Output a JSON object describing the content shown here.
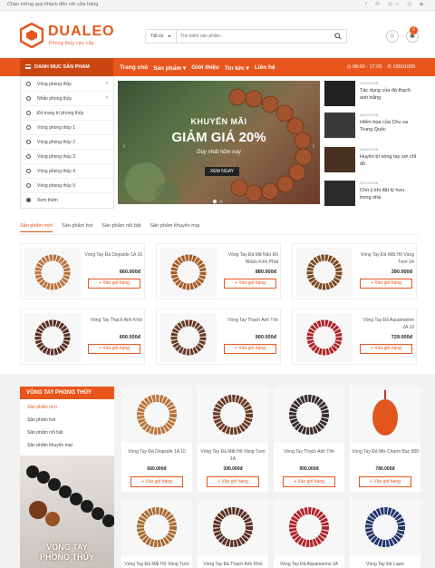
{
  "topbar": {
    "welcome": "Chào mừng quý khách đến với cửa hàng",
    "social": "f ✉ G+ ◎ ▶"
  },
  "brand": {
    "name": "DUALEO",
    "tagline": "Phong thủy cao cấp",
    "color": "#e8561c"
  },
  "search": {
    "category": "Tất cả",
    "placeholder": "Tìm kiếm sản phẩm..."
  },
  "cart": {
    "count": "0"
  },
  "nav": {
    "menu_title": "DANH MỤC SẢN PHẨM",
    "links": [
      "Trang chủ",
      "Sản phẩm ▾",
      "Giới thiệu",
      "Tin tức ▾",
      "Liên hệ"
    ],
    "hours": "◷ 08:00 - 17:00",
    "phone": "✆ 19001009"
  },
  "sidebar": {
    "items": [
      {
        "label": "Vòng phong thủy",
        "arrow": "›"
      },
      {
        "label": "Nhẫn phong thủy",
        "arrow": "›"
      },
      {
        "label": "Đồ trang trí phong thủy",
        "arrow": ""
      },
      {
        "label": "Vòng phong thủy 1",
        "arrow": ""
      },
      {
        "label": "Vòng phong thủy 2",
        "arrow": ""
      },
      {
        "label": "Vòng phong thủy 3",
        "arrow": ""
      },
      {
        "label": "Vòng phong thủy 4",
        "arrow": ""
      },
      {
        "label": "Vòng phong thủy 5",
        "arrow": ""
      },
      {
        "label": "Xem thêm",
        "arrow": ""
      }
    ]
  },
  "banner": {
    "line1": "KHUYẾN MÃI",
    "line2": "GIẢM GIÁ 20%",
    "line3": "Duy nhất hôm nay",
    "button": "XEM NGAY"
  },
  "news": [
    {
      "date": "10/10/2018",
      "title": "Tác dụng của đá thạch anh trắng"
    },
    {
      "date": "26/10/2018",
      "title": "Hiểm họa của Chu sa Trung Quốc"
    },
    {
      "date": "26/10/2018",
      "title": "Huyền bí vòng tay sợi chỉ đỏ"
    },
    {
      "date": "26/10/2018",
      "title": "Chú ý khi đặt tỳ hưu trong nhà"
    }
  ],
  "tabs": [
    "Sản phẩm mới",
    "Sản phẩm hot",
    "Sản phẩm nổi bật",
    "Sản phẩm khuyến mại"
  ],
  "products": [
    {
      "name": "Vòng Tay Đá Diopside 1A 10",
      "price": "660.000đ",
      "add": "+ Vào giỏ hàng"
    },
    {
      "name": "Vòng Tay Đá Mã Não Đỏ Nhâm Kinh Phát",
      "price": "880.000đ",
      "add": "+ Vào giỏ hàng"
    },
    {
      "name": "Vòng Tay Đá Mắt Hổ Vàng Tươi 1A",
      "price": "390.000đ",
      "add": "+ Vào giỏ hàng"
    },
    {
      "name": "Vòng Tay Thạch Anh Khói",
      "price": "600.000đ",
      "add": "+ Vào giỏ hàng"
    },
    {
      "name": "Vòng Tay Thạch Anh Tím",
      "price": "900.000đ",
      "add": "+ Vào giỏ hàng"
    },
    {
      "name": "Vòng Tay Đá Aquamarine 2A 10",
      "price": "729.000đ",
      "add": "+ Vào giỏ hàng"
    }
  ],
  "vt_box": {
    "title": "VÒNG TAY PHONG THỦY",
    "items": [
      "Sản phẩm mới",
      "Sản phẩm hot",
      "Sản phẩm nổi bật",
      "Sản phẩm khuyến mại"
    ],
    "banner_text_1": "VÒNG TAY",
    "banner_text_2": "PHONG THỦY"
  },
  "grid": [
    {
      "name": "Vòng Tay Đá Diopside 1A 10",
      "price": "660.000đ",
      "add": "+ Vào giỏ hàng"
    },
    {
      "name": "Vòng Tay Đá Mắt Hổ Vàng Tươi 1A",
      "price": "390.000đ",
      "add": "+ Vào giỏ hàng"
    },
    {
      "name": "Vòng Tay Thạch Anh Tím",
      "price": "900.000đ",
      "add": "+ Vào giỏ hàng"
    },
    {
      "name": "Vòng Tay Đá Mix Charm Bạc 999",
      "price": "780.000đ",
      "add": "+ Vào giỏ hàng"
    },
    {
      "name": "Vòng Tay Đá Mắt Hổ Vàng Tươi",
      "price": "",
      "add": ""
    },
    {
      "name": "Vòng Tay Đá Thạch Anh Khói",
      "price": "",
      "add": ""
    },
    {
      "name": "Vòng Tay Đá Aquamarine 2A",
      "price": "",
      "add": ""
    },
    {
      "name": "Vòng Tay Đá Lapis",
      "price": "",
      "add": ""
    }
  ]
}
